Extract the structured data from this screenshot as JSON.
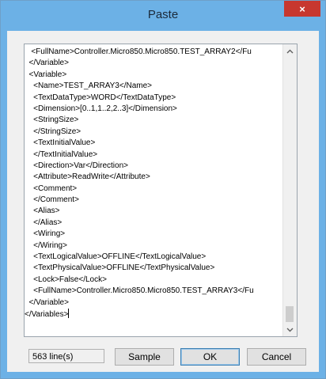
{
  "window": {
    "title": "Paste",
    "close_symbol": "×"
  },
  "editor": {
    "lines": [
      "   <FullName>Controller.Micro850.Micro850.TEST_ARRAY2</Fu",
      "  </Variable>",
      "  <Variable>",
      "    <Name>TEST_ARRAY3</Name>",
      "    <TextDataType>WORD</TextDataType>",
      "    <Dimension>[0..1,1..2,2..3]</Dimension>",
      "    <StringSize>",
      "    </StringSize>",
      "    <TextInitialValue>",
      "    </TextInitialValue>",
      "    <Direction>Var</Direction>",
      "    <Attribute>ReadWrite</Attribute>",
      "    <Comment>",
      "    </Comment>",
      "    <Alias>",
      "    </Alias>",
      "    <Wiring>",
      "    </Wiring>",
      "    <TextLogicalValue>OFFLINE</TextLogicalValue>",
      "    <TextPhysicalValue>OFFLINE</TextPhysicalValue>",
      "    <Lock>False</Lock>",
      "    <FullName>Controller.Micro850.Micro850.TEST_ARRAY3</Fu",
      "  </Variable>",
      "</Variables>"
    ]
  },
  "scrollbar": {
    "up_icon": "chevron-up-icon",
    "down_icon": "chevron-down-icon",
    "position": 0.95
  },
  "footer": {
    "line_count": "563 line(s)",
    "sample_label": "Sample",
    "ok_label": "OK",
    "cancel_label": "Cancel"
  },
  "colors": {
    "title_bar": "#6cb1e6",
    "close_button": "#c7372f",
    "dialog_bg": "#f0f0f0"
  }
}
